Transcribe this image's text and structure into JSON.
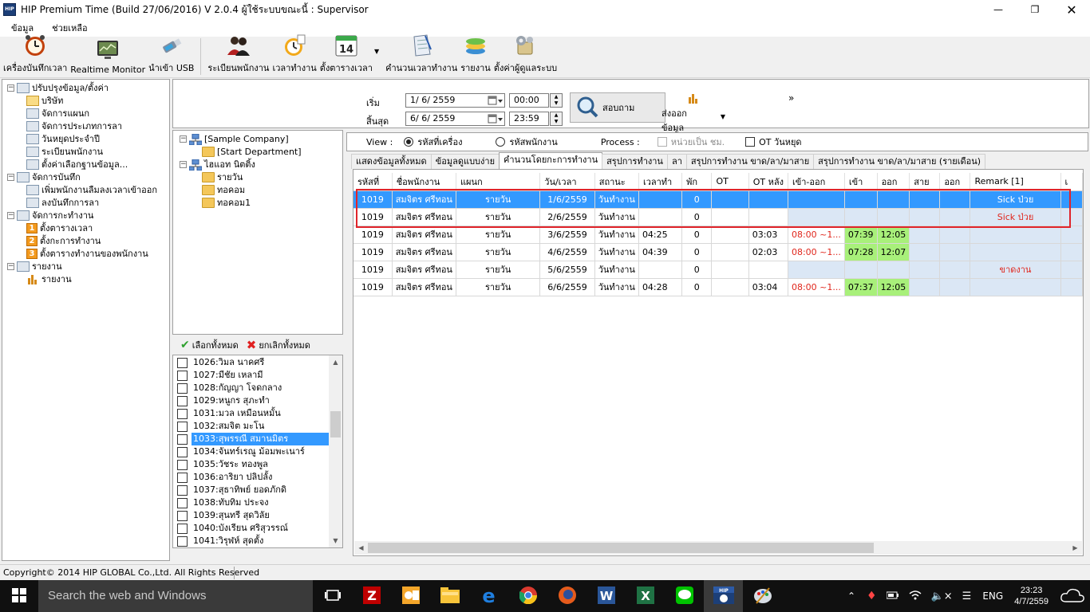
{
  "window": {
    "title": "HIP Premium Time (Build 27/06/2016) V 2.0.4   ผู้ใช้ระบบขณะนี้ : Supervisor",
    "icon_text": "HIP"
  },
  "menu": [
    "ข้อมูล",
    "ช่วยเหลือ"
  ],
  "toolbar": [
    {
      "label": "เครื่องบันทึกเวลา",
      "icon": "alarm-clock-icon"
    },
    {
      "label": "Realtime Monitor",
      "icon": "monitor-icon"
    },
    {
      "label": "นำเข้า USB",
      "icon": "usb-icon"
    },
    {
      "label": "ระเบียนพนักงาน",
      "icon": "employees-icon"
    },
    {
      "label": "เวลาทำงาน",
      "icon": "stopwatch-icon"
    },
    {
      "label": "ตั้งตารางเวลา",
      "icon": "calendar-icon",
      "badge": "14"
    },
    {
      "label": "คำนวนเวลาทำงาน",
      "icon": "notepad-icon"
    },
    {
      "label": "รายงาน",
      "icon": "report-icon"
    },
    {
      "label": "ตั้งค่าผู้ดูแลระบบ",
      "icon": "admin-settings-icon"
    }
  ],
  "nav_tree": [
    {
      "label": "ปรับปรุงข้อมูล/ตั้งค่า",
      "level": 0,
      "toggle": "−",
      "icon": "calc"
    },
    {
      "label": "บริษัท",
      "level": 1,
      "icon": "folder-open"
    },
    {
      "label": "จัดการแผนก",
      "level": 1,
      "icon": "calc"
    },
    {
      "label": "จัดการประเภทการลา",
      "level": 1,
      "icon": "calc"
    },
    {
      "label": "วันหยุดประจำปี",
      "level": 1,
      "icon": "calc"
    },
    {
      "label": "ระเบียนพนักงาน",
      "level": 1,
      "icon": "calc"
    },
    {
      "label": "ตั้งค่าเลือกฐานข้อมูล...",
      "level": 1,
      "icon": "calc"
    },
    {
      "label": "จัดการบันทึก",
      "level": 0,
      "toggle": "−",
      "icon": "calc"
    },
    {
      "label": "เพิ่มพนักงานลืมลงเวลาเข้าออก",
      "level": 1,
      "icon": "calc"
    },
    {
      "label": "ลงบันทึกการลา",
      "level": 1,
      "icon": "calc"
    },
    {
      "label": "จัดการกะทำงาน",
      "level": 0,
      "toggle": "−",
      "icon": "calc"
    },
    {
      "label": "ตั้งตารางเวลา",
      "level": 1,
      "icon": "num",
      "num": "1"
    },
    {
      "label": "ตั้งกะการทำงาน",
      "level": 1,
      "icon": "num",
      "num": "2"
    },
    {
      "label": "ตั้งตารางทำงานของพนักงาน",
      "level": 1,
      "icon": "num",
      "num": "3"
    },
    {
      "label": "รายงาน",
      "level": 0,
      "toggle": "−",
      "icon": "calc"
    },
    {
      "label": "รายงาน",
      "level": 1,
      "icon": "chart"
    }
  ],
  "filter": {
    "start_label": "เริ่ม",
    "end_label": "สิ้นสุด",
    "start_date": "1/ 6/ 2559",
    "end_date": "6/ 6/ 2559",
    "start_time": "00:00",
    "end_time": "23:59",
    "search_label": "สอบถาม",
    "export_label": "ส่งออกข้อมูล",
    "more": "»"
  },
  "company_tree": [
    {
      "label": "[Sample Company]",
      "level": 0,
      "toggle": "−",
      "icon": "network"
    },
    {
      "label": "[Start Department]",
      "level": 1,
      "icon": "folder"
    },
    {
      "label": "ไฮแอท นิตติ้ง",
      "level": 0,
      "toggle": "−",
      "icon": "network"
    },
    {
      "label": "รายวัน",
      "level": 1,
      "icon": "folder"
    },
    {
      "label": "ทอคอม",
      "level": 1,
      "icon": "folder"
    },
    {
      "label": "ทอคอม1",
      "level": 1,
      "icon": "folder"
    }
  ],
  "select_bar": {
    "select_all": "เลือกทั้งหมด",
    "deselect_all": "ยกเลิกทั้งหมด"
  },
  "employees": [
    {
      "label": "1026:วิมล นาคศรี",
      "selected": false
    },
    {
      "label": "1027:มีชัย เหลามี",
      "selected": false
    },
    {
      "label": "1028:กัญญา โจดกลาง",
      "selected": false
    },
    {
      "label": "1029:หนูกร สุภะทำ",
      "selected": false
    },
    {
      "label": "1031:มวล เหมือนหมั้น",
      "selected": false
    },
    {
      "label": "1032:สมจิต มะโน",
      "selected": false
    },
    {
      "label": "1033:สุพรรณี สมานมิตร",
      "selected": true
    },
    {
      "label": "1034:จันทร์เรณู ม้อมพะเนาร์",
      "selected": false
    },
    {
      "label": "1035:วัชระ ทองพูล",
      "selected": false
    },
    {
      "label": "1036:อาริยา ปลิปลั้ง",
      "selected": false
    },
    {
      "label": "1037:สุธาทิพย์ ยอดภักดิ",
      "selected": false
    },
    {
      "label": "1038:ทับทิม ประจง",
      "selected": false
    },
    {
      "label": "1039:สุนทรี สุดวิลัย",
      "selected": false
    },
    {
      "label": "1040:บังเรียน ศริสุวรรณ์",
      "selected": false
    },
    {
      "label": "1041:วิรุฬห์ สุดตั้ง",
      "selected": false
    }
  ],
  "view": {
    "label": "View :",
    "opt1": "รหัสที่เครื่อง",
    "opt2": "รหัสพนักงาน",
    "process_label": "Process :",
    "unit_hours": "หน่วยเป็น ชม.",
    "ot_holiday": "OT วันหยุด"
  },
  "tabs": [
    {
      "label": "แสดงข้อมูลทั้งหมด",
      "active": false
    },
    {
      "label": "ข้อมูลดูแบบง่าย",
      "active": false
    },
    {
      "label": "คำนวนโดยกะการทำงาน",
      "active": true
    },
    {
      "label": "สรุปการทำงาน",
      "active": false
    },
    {
      "label": "ลา",
      "active": false
    },
    {
      "label": "สรุปการทำงาน ขาด/ลา/มาสาย",
      "active": false
    },
    {
      "label": "สรุปการทำงาน ขาด/ลา/มาสาย (รายเดือน)",
      "active": false
    }
  ],
  "grid": {
    "columns": [
      "รหัสที่",
      "ชื่อพนักงาน",
      "แผนก",
      "วัน/เวลา",
      "สถานะ",
      "เวลาทำ",
      "พัก",
      "OT",
      "OT หลัง",
      "เข้า-ออก",
      "เข้า",
      "ออก",
      "สาย",
      "ออก",
      "Remark [1]",
      "เ"
    ],
    "rows": [
      {
        "selected": true,
        "cells": [
          "1019",
          "สมจิตร ศรีทอน",
          "รายวัน",
          "1/6/2559",
          "วันทำงาน",
          "",
          "0",
          "",
          "",
          "",
          "",
          "",
          "",
          "",
          "Sick ป่วย"
        ]
      },
      {
        "selected": false,
        "cells": [
          "1019",
          "สมจิตร ศรีทอน",
          "รายวัน",
          "2/6/2559",
          "วันทำงาน",
          "",
          "0",
          "",
          "",
          "",
          "",
          "",
          "",
          "",
          "Sick ป่วย"
        ]
      },
      {
        "selected": false,
        "cells": [
          "1019",
          "สมจิตร ศรีทอน",
          "รายวัน",
          "3/6/2559",
          "วันทำงาน",
          "04:25",
          "0",
          "",
          "03:03",
          "08:00 ~1...",
          "07:39",
          "12:05",
          "",
          "",
          ""
        ]
      },
      {
        "selected": false,
        "cells": [
          "1019",
          "สมจิตร ศรีทอน",
          "รายวัน",
          "4/6/2559",
          "วันทำงาน",
          "04:39",
          "0",
          "",
          "02:03",
          "08:00 ~1...",
          "07:28",
          "12:07",
          "",
          "",
          ""
        ]
      },
      {
        "selected": false,
        "cells": [
          "1019",
          "สมจิตร ศรีทอน",
          "รายวัน",
          "5/6/2559",
          "วันทำงาน",
          "",
          "0",
          "",
          "",
          "",
          "",
          "",
          "",
          "",
          "ขาดงาน"
        ]
      },
      {
        "selected": false,
        "cells": [
          "1019",
          "สมจิตร ศรีทอน",
          "รายวัน",
          "6/6/2559",
          "วันทำงาน",
          "04:28",
          "0",
          "",
          "03:04",
          "08:00 ~1...",
          "07:37",
          "12:05",
          "",
          "",
          ""
        ]
      }
    ]
  },
  "status": {
    "copyright": "Copyright© 2014 HIP GLOBAL Co.,Ltd. All Rights Reserved"
  },
  "taskbar": {
    "search_placeholder": "Search the web and Windows",
    "apps": [
      "task-view-icon",
      "filezilla-icon",
      "outlook-icon",
      "file-explorer-icon",
      "edge-icon",
      "chrome-icon",
      "firefox-icon",
      "word-icon",
      "excel-icon",
      "line-icon",
      "hip-time-icon",
      "paint-icon"
    ],
    "hip_text": "HIP",
    "lang": "ENG",
    "time": "23:23",
    "date": "4/7/2559"
  },
  "colors": {
    "selection": "#3399ff",
    "highlight_box": "#e0242a",
    "green_cell": "#a8f07a",
    "blue_cell": "#dbe7f5",
    "red_text": "#e0261c"
  }
}
